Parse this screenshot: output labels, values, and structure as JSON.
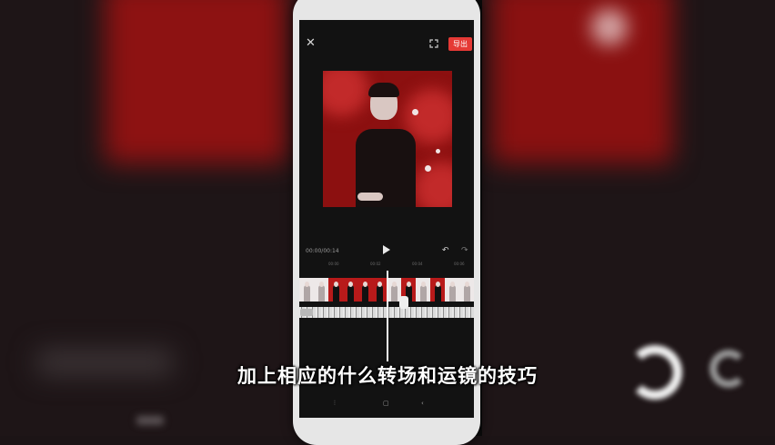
{
  "editor": {
    "export_label": "导出",
    "timecode": "00:00/00:14",
    "ruler_ticks": [
      "00:00",
      "00:02",
      "00:04",
      "00:06",
      "00:08"
    ]
  },
  "toolbar": {
    "close_icon": "close-icon",
    "fullscreen_icon": "fullscreen-icon",
    "play_icon": "play-icon",
    "undo_icon": "undo-icon",
    "redo_icon": "redo-icon"
  },
  "subtitle": "加上相应的什么转场和运镜的技巧",
  "colors": {
    "accent": "#e53935",
    "preview_bg": "#8c1010",
    "background": "#1e1517"
  }
}
